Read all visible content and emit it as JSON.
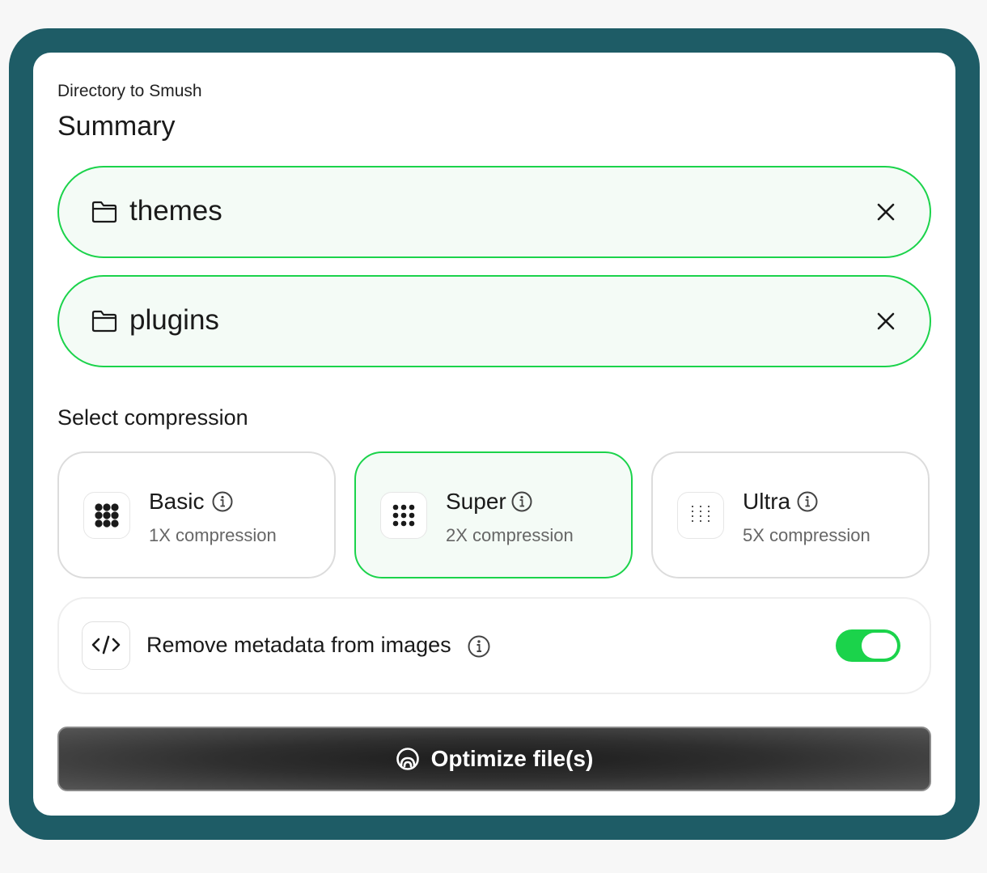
{
  "header": {
    "subtitle": "Directory to Smush",
    "title": "Summary"
  },
  "directories": [
    {
      "name": "themes",
      "icon": "folder-icon",
      "remove_icon": "close-icon"
    },
    {
      "name": "plugins",
      "icon": "folder-icon",
      "remove_icon": "close-icon"
    }
  ],
  "compression": {
    "label": "Select compression",
    "selected": "Super",
    "options": [
      {
        "name": "Basic",
        "description": "1X compression",
        "icon": "dense-dots-icon"
      },
      {
        "name": "Super",
        "description": "2X compression",
        "icon": "medium-dots-icon"
      },
      {
        "name": "Ultra",
        "description": "5X compression",
        "icon": "sparse-dots-icon"
      }
    ]
  },
  "metadata": {
    "label": "Remove metadata from images",
    "icon": "code-icon",
    "enabled": true
  },
  "action": {
    "label": "Optimize file(s)",
    "icon": "smush-logo-icon"
  },
  "colors": {
    "frame": "#1e5c66",
    "accent": "#1bd34b",
    "selected_bg": "#f4fbf6",
    "button_dark": "#2f2f2f"
  }
}
